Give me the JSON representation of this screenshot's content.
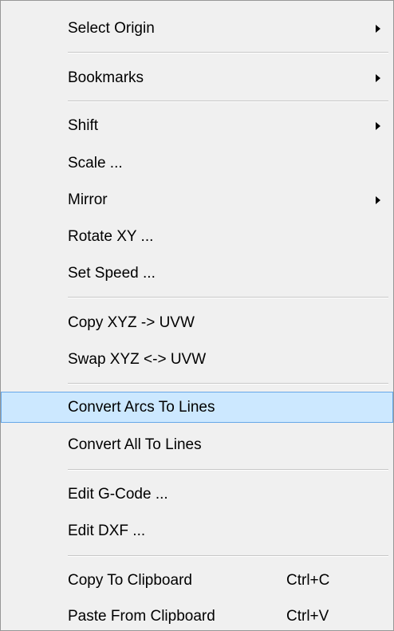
{
  "menu": {
    "items": [
      {
        "label": "Select Origin",
        "submenu": true
      },
      {
        "label": "Bookmarks",
        "submenu": true
      },
      {
        "label": "Shift",
        "submenu": true
      },
      {
        "label": "Scale ..."
      },
      {
        "label": "Mirror",
        "submenu": true
      },
      {
        "label": "Rotate XY ..."
      },
      {
        "label": "Set Speed ..."
      },
      {
        "label": "Copy XYZ -> UVW"
      },
      {
        "label": "Swap XYZ <-> UVW"
      },
      {
        "label": "Convert Arcs To Lines",
        "highlighted": true
      },
      {
        "label": "Convert All To Lines"
      },
      {
        "label": "Edit G-Code ..."
      },
      {
        "label": "Edit DXF ..."
      },
      {
        "label": "Copy To Clipboard",
        "shortcut": "Ctrl+C"
      },
      {
        "label": "Paste From Clipboard",
        "shortcut": "Ctrl+V"
      }
    ]
  },
  "colors": {
    "menu_background": "#f0f0f0",
    "highlight_background": "#cce8ff",
    "highlight_border": "#66a7e8",
    "separator": "#c7c7c7"
  }
}
